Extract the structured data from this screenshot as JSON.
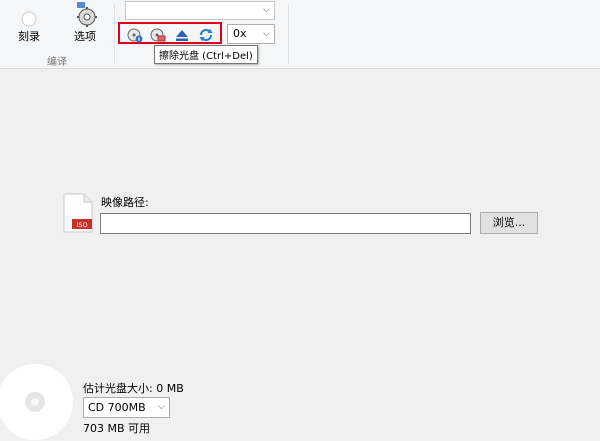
{
  "ribbon": {
    "burn_label": "刻录",
    "options_label": "选项",
    "group_label": "编译",
    "speed_value": "",
    "zoom_value": "0x",
    "toolbar_icons": [
      "disc-info-icon",
      "erase-disc-icon",
      "eject-icon",
      "refresh-icon"
    ],
    "tooltip": "擦除光盘 (Ctrl+Del)"
  },
  "image": {
    "path_label": "映像路径:",
    "path_value": "",
    "browse_label": "浏览...",
    "iso_badge": "ISO"
  },
  "status": {
    "estimated_size": "估计光盘大小: 0 MB",
    "disc_type": "CD 700MB",
    "available": "703 MB 可用"
  },
  "colors": {
    "highlight": "#e0001b",
    "iso_badge": "#c9302c"
  }
}
